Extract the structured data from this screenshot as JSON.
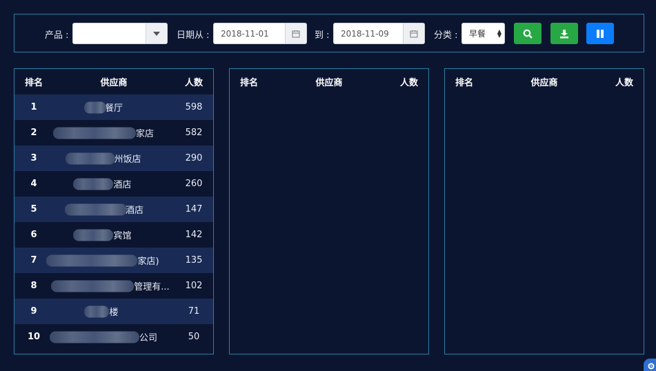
{
  "filters": {
    "product_label": "产品 :",
    "product_value": "",
    "date_from_label": "日期从 :",
    "date_from": "2018-11-01",
    "date_to_label": "到 :",
    "date_to": "2018-11-09",
    "category_label": "分类 :",
    "category_value": "早餐"
  },
  "buttons": {
    "search_icon": "search-icon",
    "export_icon": "download-icon",
    "toggle_icon": "pause-icon"
  },
  "columns": {
    "rank": "排名",
    "supplier": "供应商",
    "count": "人数"
  },
  "tables": [
    {
      "rows": [
        {
          "rank": "1",
          "supplier": "餐厅",
          "count": "598"
        },
        {
          "rank": "2",
          "supplier": "家店",
          "count": "582"
        },
        {
          "rank": "3",
          "supplier": "州饭店",
          "count": "290"
        },
        {
          "rank": "4",
          "supplier": "酒店",
          "count": "260"
        },
        {
          "rank": "5",
          "supplier": "酒店",
          "count": "147"
        },
        {
          "rank": "6",
          "supplier": "宾馆",
          "count": "142"
        },
        {
          "rank": "7",
          "supplier": "家店)",
          "count": "135"
        },
        {
          "rank": "8",
          "supplier": "管理有...",
          "count": "102"
        },
        {
          "rank": "9",
          "supplier": "楼",
          "count": "71"
        },
        {
          "rank": "10",
          "supplier": "公司",
          "count": "50"
        }
      ]
    },
    {
      "rows": []
    },
    {
      "rows": []
    }
  ],
  "colors": {
    "background": "#0c1530",
    "border": "#2d7fa3",
    "row_alt": "#192b55",
    "green": "#27a844",
    "blue": "#0b7dfc"
  }
}
